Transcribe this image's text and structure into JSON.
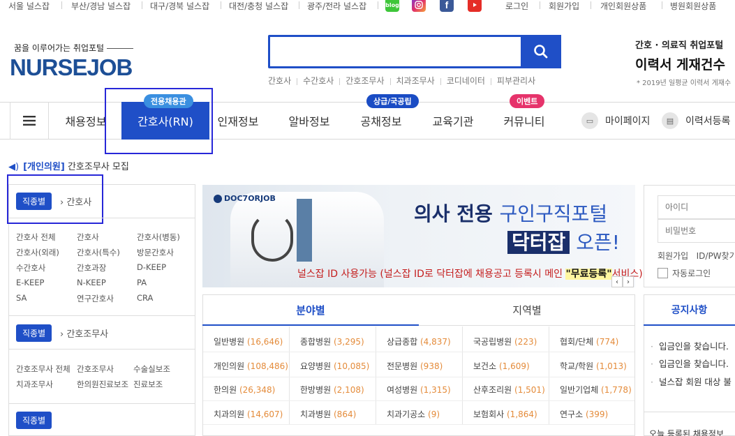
{
  "topbar": {
    "regions": [
      "서울 널스잡",
      "부산/경남 널스잡",
      "대구/경북 널스잡",
      "대전/충청 널스잡",
      "광주/전라 널스잡"
    ],
    "social": {
      "blog": "blog"
    },
    "links": [
      "로그인",
      "회원가입",
      "개인회원상품",
      "병원회원상품"
    ]
  },
  "header": {
    "tagline": "꿈을 이루어가는 취업포털",
    "logo": "NURSEJOB",
    "search_placeholder": "",
    "quick_links": [
      "간호사",
      "수간호사",
      "간호조무사",
      "치과조무사",
      "코디네이터",
      "피부관리사"
    ],
    "resume_category": "간호 · 의료직 취업포털",
    "resume_title": "이력서 게재건수",
    "resume_note": "* 2019년 일평균 이력서 게재수"
  },
  "nav": {
    "items": [
      "채용정보",
      "간호사(RN)",
      "인재정보",
      "알바정보",
      "공채정보",
      "교육기관",
      "커뮤니티"
    ],
    "badges": {
      "rn": "전용채용관",
      "public": "상급/국공립",
      "event": "이벤트"
    },
    "right": [
      "마이페이지",
      "이력서등록"
    ]
  },
  "notice_bar": {
    "tag": "[개인의원]",
    "text": "간호조무사 모집"
  },
  "left_panel": {
    "sections": [
      {
        "chip": "직종별",
        "crumb": "간호사",
        "categories": [
          "간호사 전체",
          "간호사",
          "간호사(병동)",
          "간호사(외래)",
          "간호사(특수)",
          "방문간호사",
          "수간호사",
          "간호과장",
          "D-KEEP",
          "E-KEEP",
          "N-KEEP",
          "PA",
          "SA",
          "연구간호사",
          "CRA"
        ]
      },
      {
        "chip": "직종별",
        "crumb": "간호조무사",
        "categories": [
          "간호조무사 전체",
          "간호조무사",
          "수술실보조",
          "치과조무사",
          "한의원진료보조",
          "진료보조"
        ]
      },
      {
        "chip": "직종별"
      }
    ]
  },
  "banner": {
    "logo": "DOC7ORJOB",
    "line1_a": "의사 전용",
    "line1_b": "구인구직포털",
    "line2_a": "닥터잡",
    "line2_b": "오픈!",
    "line3_a": "널스잡 ID 사용가능 (널스잡 ID로 닥터잡에 채용공고 등록시 메인",
    "line3_b": "\"무료등록\"",
    "line3_c": "서비스)"
  },
  "stats": {
    "tabs": [
      "분야별",
      "지역별"
    ],
    "rows": [
      [
        {
          "name": "일반병원",
          "count": "(16,646)"
        },
        {
          "name": "종합병원",
          "count": "(3,295)"
        },
        {
          "name": "상급종합",
          "count": "(4,837)"
        },
        {
          "name": "국공립병원",
          "count": "(223)"
        },
        {
          "name": "협회/단체",
          "count": "(774)"
        }
      ],
      [
        {
          "name": "개인의원",
          "count": "(108,486)"
        },
        {
          "name": "요양병원",
          "count": "(10,085)"
        },
        {
          "name": "전문병원",
          "count": "(938)"
        },
        {
          "name": "보건소",
          "count": "(1,609)"
        },
        {
          "name": "학교/학원",
          "count": "(1,013)"
        }
      ],
      [
        {
          "name": "한의원",
          "count": "(26,348)"
        },
        {
          "name": "한방병원",
          "count": "(2,108)"
        },
        {
          "name": "여성병원",
          "count": "(1,315)"
        },
        {
          "name": "산후조리원",
          "count": "(1,501)"
        },
        {
          "name": "일반기업체",
          "count": "(1,778)"
        }
      ],
      [
        {
          "name": "치과의원",
          "count": "(14,607)"
        },
        {
          "name": "치과병원",
          "count": "(864)"
        },
        {
          "name": "치과기공소",
          "count": "(9)"
        },
        {
          "name": "보험회사",
          "count": "(1,864)"
        },
        {
          "name": "연구소",
          "count": "(399)"
        }
      ]
    ]
  },
  "login": {
    "id_placeholder": "아이디",
    "pw_placeholder": "비밀번호",
    "join": "회원가입",
    "find": "ID/PW찾기",
    "auto": "자동로그인"
  },
  "notice": {
    "title": "공지사항",
    "items": [
      "입금인을 찾습니다.",
      "입금인을 찾습니다.",
      "널스잡 회원 대상 불"
    ],
    "footer": "오늘 등록된 채용정보"
  }
}
